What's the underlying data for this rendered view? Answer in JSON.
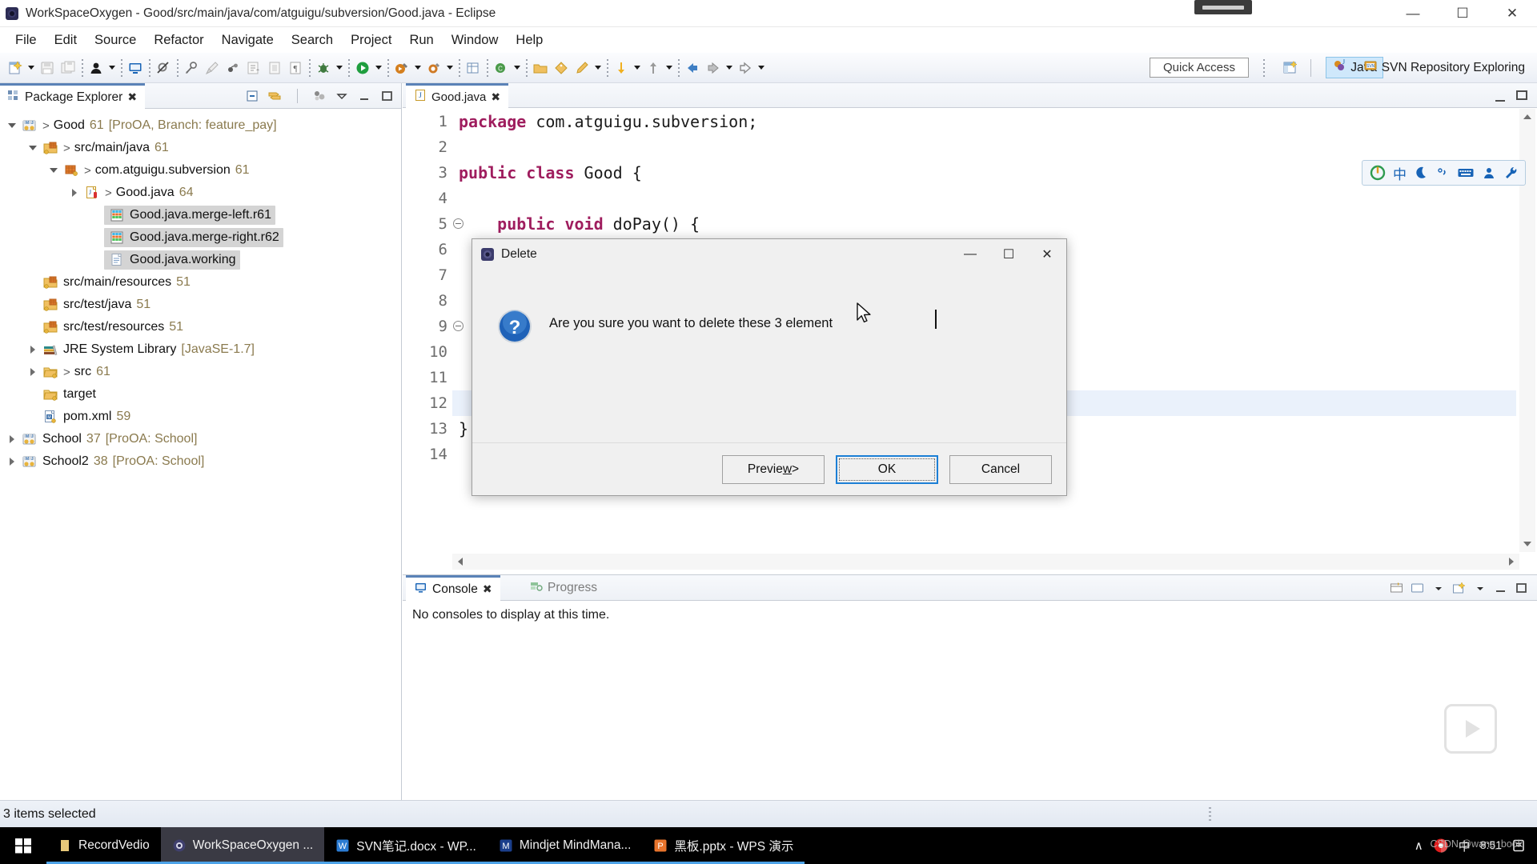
{
  "window": {
    "title": "WorkSpaceOxygen - Good/src/main/java/com/atguigu/subversion/Good.java - Eclipse",
    "minimize": "—",
    "maximize": "☐",
    "close": "✕"
  },
  "menu": {
    "items": [
      "File",
      "Edit",
      "Source",
      "Refactor",
      "Navigate",
      "Search",
      "Project",
      "Run",
      "Window",
      "Help"
    ]
  },
  "toolbar": {
    "quick_access": "Quick Access",
    "perspectives": [
      {
        "label": "Java",
        "active": true
      },
      {
        "label": "SVN Repository Exploring",
        "active": false
      }
    ]
  },
  "package_explorer": {
    "tab_label": "Package Explorer",
    "tab_close": "✖",
    "tree": [
      {
        "indent": 0,
        "twisty": "open",
        "icon": "java-project-icon",
        "arrow": ">",
        "label": "Good",
        "num": "61",
        "bracket": "[ProOA, Branch: feature_pay]",
        "selected": false
      },
      {
        "indent": 1,
        "twisty": "open",
        "icon": "source-folder-icon",
        "arrow": ">",
        "label": "src/main/java",
        "num": "61",
        "bracket": "",
        "selected": false
      },
      {
        "indent": 2,
        "twisty": "open",
        "icon": "package-icon",
        "arrow": ">",
        "label": "com.atguigu.subversion",
        "num": "61",
        "bracket": "",
        "selected": false
      },
      {
        "indent": 3,
        "twisty": "closed",
        "icon": "java-file-icon",
        "arrow": ">",
        "label": "Good.java",
        "num": "64",
        "bracket": "",
        "selected": false
      },
      {
        "indent": 4,
        "twisty": "none",
        "icon": "merge-file-icon",
        "arrow": "",
        "label": "Good.java.merge-left.r61",
        "num": "",
        "bracket": "",
        "selected": true
      },
      {
        "indent": 4,
        "twisty": "none",
        "icon": "merge-file-icon",
        "arrow": "",
        "label": "Good.java.merge-right.r62",
        "num": "",
        "bracket": "",
        "selected": true
      },
      {
        "indent": 4,
        "twisty": "none",
        "icon": "text-file-icon",
        "arrow": "",
        "label": "Good.java.working",
        "num": "",
        "bracket": "",
        "selected": true
      },
      {
        "indent": 1,
        "twisty": "none",
        "icon": "source-folder-icon",
        "arrow": "",
        "label": "src/main/resources",
        "num": "51",
        "bracket": "",
        "selected": false
      },
      {
        "indent": 1,
        "twisty": "none",
        "icon": "source-folder-icon",
        "arrow": "",
        "label": "src/test/java",
        "num": "51",
        "bracket": "",
        "selected": false
      },
      {
        "indent": 1,
        "twisty": "none",
        "icon": "source-folder-icon",
        "arrow": "",
        "label": "src/test/resources",
        "num": "51",
        "bracket": "",
        "selected": false
      },
      {
        "indent": 1,
        "twisty": "closed",
        "icon": "library-icon",
        "arrow": "",
        "label": "JRE System Library",
        "num": "",
        "bracket": "[JavaSE-1.7]",
        "selected": false
      },
      {
        "indent": 1,
        "twisty": "closed",
        "icon": "folder-icon",
        "arrow": ">",
        "label": "src",
        "num": "61",
        "bracket": "",
        "selected": false
      },
      {
        "indent": 1,
        "twisty": "none",
        "icon": "folder-icon",
        "arrow": "",
        "label": "target",
        "num": "",
        "bracket": "",
        "selected": false
      },
      {
        "indent": 1,
        "twisty": "none",
        "icon": "xml-file-icon",
        "arrow": "",
        "label": "pom.xml",
        "num": "59",
        "bracket": "",
        "selected": false
      },
      {
        "indent": 0,
        "twisty": "closed",
        "icon": "java-project-icon",
        "arrow": "",
        "label": "School",
        "num": "37",
        "bracket": "[ProOA: School]",
        "selected": false
      },
      {
        "indent": 0,
        "twisty": "closed",
        "icon": "java-project-icon",
        "arrow": "",
        "label": "School2",
        "num": "38",
        "bracket": "[ProOA: School]",
        "selected": false
      }
    ]
  },
  "editor": {
    "tab_label": "Good.java",
    "tab_close": "✖",
    "lines": [
      {
        "num": "1",
        "fold": false,
        "segments": [
          {
            "t": "package",
            "k": true
          },
          {
            "t": " com.atguigu.subversion;",
            "k": false
          }
        ]
      },
      {
        "num": "2",
        "fold": false,
        "segments": [
          {
            "t": "",
            "k": false
          }
        ]
      },
      {
        "num": "3",
        "fold": false,
        "segments": [
          {
            "t": "public class",
            "k": true
          },
          {
            "t": " Good {",
            "k": false
          }
        ]
      },
      {
        "num": "4",
        "fold": false,
        "segments": [
          {
            "t": "",
            "k": false
          }
        ]
      },
      {
        "num": "5",
        "fold": true,
        "segments": [
          {
            "t": "    public void",
            "k": true
          },
          {
            "t": " doPay() {",
            "k": false
          }
        ]
      },
      {
        "num": "6",
        "fold": false,
        "segments": [
          {
            "t": "",
            "k": false
          }
        ]
      },
      {
        "num": "7",
        "fold": false,
        "segments": [
          {
            "t": "",
            "k": false
          }
        ]
      },
      {
        "num": "8",
        "fold": false,
        "segments": [
          {
            "t": "",
            "k": false
          }
        ]
      },
      {
        "num": "9",
        "fold": true,
        "segments": [
          {
            "t": "",
            "k": false
          }
        ]
      },
      {
        "num": "10",
        "fold": false,
        "segments": [
          {
            "t": "",
            "k": false
          }
        ]
      },
      {
        "num": "11",
        "fold": false,
        "segments": [
          {
            "t": "",
            "k": false
          }
        ]
      },
      {
        "num": "12",
        "fold": false,
        "segments": [
          {
            "t": "",
            "k": false
          }
        ]
      },
      {
        "num": "13",
        "fold": false,
        "segments": [
          {
            "t": "}",
            "k": false
          }
        ]
      },
      {
        "num": "14",
        "fold": false,
        "segments": [
          {
            "t": "",
            "k": false
          }
        ]
      }
    ]
  },
  "console": {
    "tabs": [
      {
        "label": "Console",
        "active": true,
        "close": "✖"
      },
      {
        "label": "Progress",
        "active": false,
        "close": ""
      }
    ],
    "message": "No consoles to display at this time."
  },
  "dialog": {
    "title": "Delete",
    "message": "Are you sure you want to delete these 3 element",
    "minimize": "—",
    "maximize": "☐",
    "close": "✕",
    "buttons": [
      {
        "id": "preview",
        "pre": "Previe",
        "mnemonic": "w",
        "post": " >",
        "default": false
      },
      {
        "id": "ok",
        "pre": "OK",
        "mnemonic": "",
        "post": "",
        "default": true
      },
      {
        "id": "cancel",
        "pre": "Cancel",
        "mnemonic": "",
        "post": "",
        "default": false
      }
    ]
  },
  "statusbar": {
    "text": "3 items selected"
  },
  "taskbar": {
    "items": [
      {
        "label": "RecordVedio",
        "icon": "folder-icon",
        "active": false
      },
      {
        "label": "WorkSpaceOxygen ...",
        "icon": "eclipse-icon",
        "active": true
      },
      {
        "label": "SVN笔记.docx - WP...",
        "icon": "word-icon",
        "active": false
      },
      {
        "label": "Mindjet MindMana...",
        "icon": "mindjet-icon",
        "active": false
      },
      {
        "label": "黑板.pptx - WPS 演示",
        "icon": "powerpoint-icon",
        "active": false
      }
    ],
    "tray": {
      "chevron": "∧",
      "ime": "中",
      "time": "8:51",
      "watermark": "CSDN @wang_book"
    }
  },
  "ime_bar": {
    "items": [
      "power-icon",
      "中",
      "moon-icon",
      "punctuation-icon",
      "keyboard-icon",
      "user-icon",
      "wrench-icon"
    ]
  }
}
